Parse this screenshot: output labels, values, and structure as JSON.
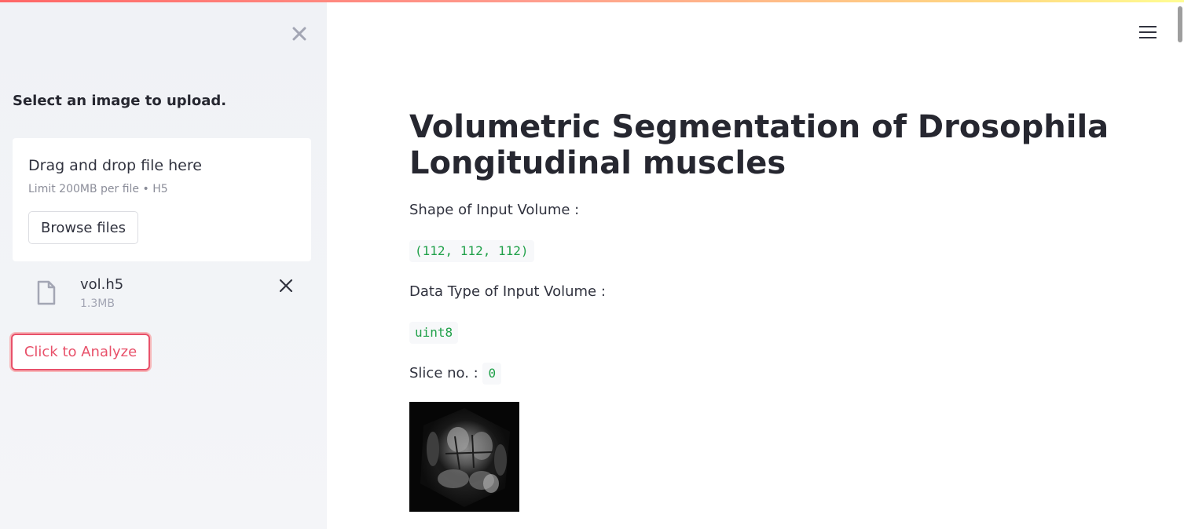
{
  "sidebar": {
    "title": "Select an image to upload.",
    "uploader": {
      "drop_text": "Drag and drop file here",
      "limit_text": "Limit 200MB per file • H5",
      "browse_label": "Browse files"
    },
    "file": {
      "name": "vol.h5",
      "size": "1.3MB"
    },
    "analyze_label": "Click to Analyze"
  },
  "main": {
    "title": "Volumetric Segmentation of Drosophila Longitudinal muscles",
    "shape_label": "Shape of Input Volume :",
    "shape_value": "(112, 112, 112)",
    "dtype_label": "Data Type of Input Volume :",
    "dtype_value": "uint8",
    "slice_label": "Slice no. :",
    "slice_value": "0"
  },
  "colors": {
    "accent": "#ff4b4b",
    "code_text": "#21a14a",
    "sidebar_bg": "#f0f2f6"
  },
  "icons": [
    "close-icon",
    "file-icon",
    "delete-file-icon",
    "hamburger-menu-icon"
  ]
}
